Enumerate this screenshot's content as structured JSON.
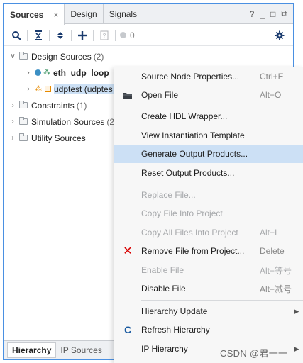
{
  "tabs": [
    {
      "label": "Sources",
      "active": true,
      "close": "×"
    },
    {
      "label": "Design",
      "active": false
    },
    {
      "label": "Signals",
      "active": false
    }
  ],
  "window_buttons": {
    "help": "?",
    "minimize": "_",
    "maximize": "□",
    "float": "⧉"
  },
  "toolbar": {
    "icons": [
      "search-icon",
      "collapse-all-icon",
      "expand-all-icon",
      "add-icon",
      "properties-icon",
      "status-dot-icon",
      "gear-icon"
    ],
    "count": "0"
  },
  "tree": {
    "design_sources": {
      "label": "Design Sources",
      "count": "(2)"
    },
    "item1": {
      "label": "eth_udp_loop"
    },
    "item2": {
      "label": "udptest (udptes"
    },
    "constraints": {
      "label": "Constraints",
      "count": "(1)"
    },
    "simulation": {
      "label": "Simulation Sources",
      "count": "(2"
    },
    "utility": {
      "label": "Utility Sources"
    }
  },
  "bottom_tabs": [
    {
      "label": "Hierarchy",
      "active": true
    },
    {
      "label": "IP Sources",
      "active": false
    }
  ],
  "menu": {
    "items": [
      {
        "label": "Source Node Properties...",
        "shortcut": "Ctrl+E",
        "enabled": true
      },
      {
        "label": "Open File",
        "shortcut": "Alt+O",
        "enabled": true
      },
      {
        "label": "Create HDL Wrapper...",
        "shortcut": "",
        "enabled": true
      },
      {
        "label": "View Instantiation Template",
        "shortcut": "",
        "enabled": true
      },
      {
        "label": "Generate Output Products...",
        "shortcut": "",
        "enabled": true,
        "highlighted": true
      },
      {
        "label": "Reset Output Products...",
        "shortcut": "",
        "enabled": true
      },
      {
        "label": "Replace File...",
        "shortcut": "",
        "enabled": false
      },
      {
        "label": "Copy File Into Project",
        "shortcut": "",
        "enabled": false
      },
      {
        "label": "Copy All Files Into Project",
        "shortcut": "Alt+I",
        "enabled": false
      },
      {
        "label": "Remove File from Project...",
        "shortcut": "Delete",
        "enabled": true
      },
      {
        "label": "Enable File",
        "shortcut": "Alt+等号",
        "enabled": false
      },
      {
        "label": "Disable File",
        "shortcut": "Alt+减号",
        "enabled": true
      },
      {
        "label": "Hierarchy Update",
        "shortcut": "",
        "enabled": true,
        "submenu": true
      },
      {
        "label": "Refresh Hierarchy",
        "shortcut": "",
        "enabled": true
      },
      {
        "label": "IP Hierarchy",
        "shortcut": "",
        "enabled": true,
        "submenu": true
      }
    ]
  },
  "watermark": "CSDN @君一一",
  "colors": {
    "accent_border": "#4a90e2",
    "highlight": "#cce0f5",
    "remove_icon": "#d90000"
  }
}
